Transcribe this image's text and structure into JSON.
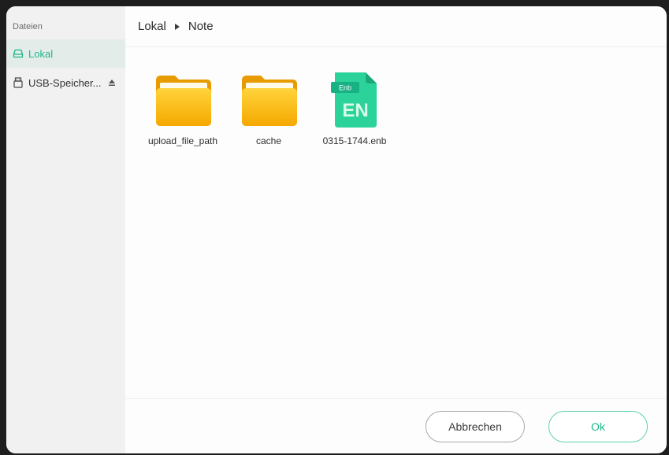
{
  "sidebar": {
    "title": "Dateien",
    "items": [
      {
        "label": "Lokal",
        "icon": "drive-icon",
        "active": true
      },
      {
        "label": "USB-Speicher...",
        "icon": "usb-drive-icon",
        "eject_icon": "eject-icon"
      }
    ]
  },
  "breadcrumb": {
    "items": [
      "Lokal",
      "Note"
    ],
    "separator_icon": "triangle-right-icon"
  },
  "files": [
    {
      "name": "upload_file_path",
      "type": "folder",
      "icon": "folder-icon"
    },
    {
      "name": "cache",
      "type": "folder",
      "icon": "folder-icon"
    },
    {
      "name": "0315-1744.enb",
      "type": "enb",
      "icon": "enb-file-icon",
      "badge": "Enb",
      "glyph": "EN"
    }
  ],
  "buttons": {
    "cancel": "Abbrechen",
    "ok": "Ok"
  },
  "colors": {
    "accent": "#19b98c",
    "folder_top": "#ffd43b",
    "folder_bottom": "#f5a800",
    "enb_icon": "#2bd39b"
  }
}
